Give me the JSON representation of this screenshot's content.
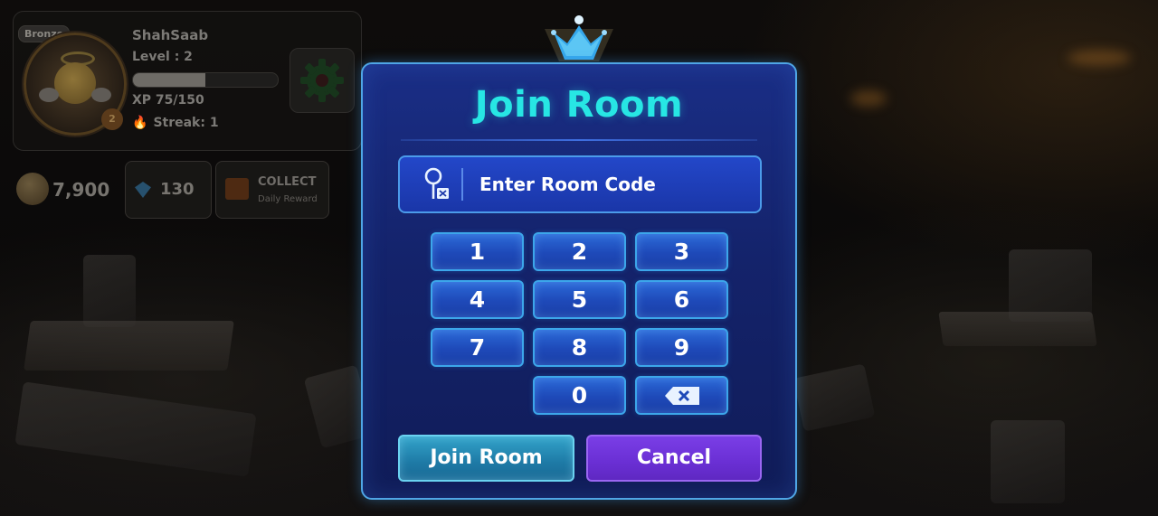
{
  "player": {
    "rank": "Bronze",
    "name": "ShahSaab",
    "level": "Level : 2",
    "level_badge": "2",
    "xp": "XP 75/150",
    "xp_progress": 0.5,
    "streak": "Streak: 1"
  },
  "currency": {
    "coins": "7,900",
    "gems": "130",
    "collect_label": "COLLECT",
    "collect_sub": "Daily Reward"
  },
  "modal": {
    "title": "Join Room",
    "code_placeholder": "Enter Room Code",
    "keys": [
      "1",
      "2",
      "3",
      "4",
      "5",
      "6",
      "7",
      "8",
      "9",
      "0"
    ],
    "join_label": "Join Room",
    "cancel_label": "Cancel"
  },
  "colors": {
    "title": "#27e6e4",
    "modal_bg": "#14236b",
    "key_bg": "#1e49b8",
    "join_bg": "#1e7aa6",
    "cancel_bg": "#6a2fd4"
  },
  "icons": [
    "crown-icon",
    "key-icon",
    "backspace-icon",
    "gear-icon",
    "gem-icon",
    "coin-icon",
    "gift-icon",
    "flame-icon"
  ]
}
